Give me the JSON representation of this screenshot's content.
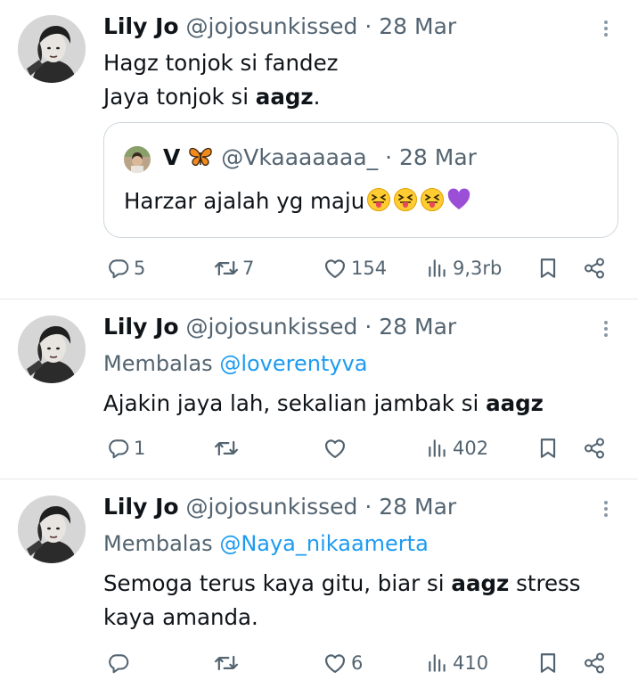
{
  "tweets": [
    {
      "name": "Lily Jo",
      "handle": "@jojosunkissed",
      "sep_date": "· 28 Mar",
      "line1": "Hagz tonjok si fandez",
      "line2_pre": "Jaya tonjok si ",
      "line2_bold": "aagz",
      "line2_post": ".",
      "quote": {
        "name": "V",
        "handle": "@Vkaaaaaaa_",
        "sep_date": "· 28 Mar",
        "text": "Harzar ajalah yg maju"
      },
      "replies": "5",
      "retweets": "7",
      "likes": "154",
      "views": "9,3rb"
    },
    {
      "name": "Lily Jo",
      "handle": "@jojosunkissed",
      "sep_date": "· 28 Mar",
      "reply_prefix": "Membalas",
      "reply_to": "@loverentyva",
      "text_pre": "Ajakin jaya lah, sekalian jambak si ",
      "text_bold": "aagz",
      "replies": "1",
      "views": "402"
    },
    {
      "name": "Lily Jo",
      "handle": "@jojosunkissed",
      "sep_date": "· 28 Mar",
      "reply_prefix": "Membalas",
      "reply_to": "@Naya_nikaamerta",
      "line1_pre": "Semoga terus kaya gitu, biar si ",
      "line1_bold": "aagz",
      "line1_post": " stress",
      "line2": "kaya amanda.",
      "likes": "6",
      "views": "410"
    }
  ],
  "icons": {
    "reply": "reply-icon",
    "retweet": "retweet-icon",
    "like": "heart-icon",
    "views": "views-icon",
    "bookmark": "bookmark-icon",
    "share": "share-icon",
    "more": "more-icon"
  },
  "colors": {
    "text": "#0f1419",
    "muted": "#536471",
    "link": "#1d9bf0",
    "border": "#cfd9de"
  }
}
